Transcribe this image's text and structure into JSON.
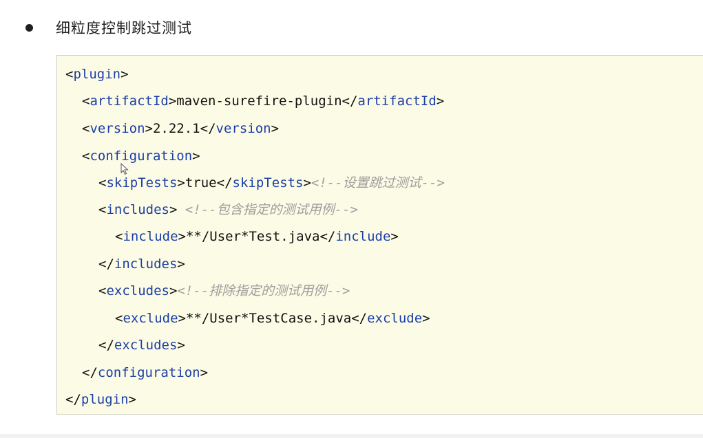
{
  "heading": "细粒度控制跳过测试",
  "code": {
    "plugin_tag": "plugin",
    "artifactId_tag": "artifactId",
    "artifactId_value": "maven-surefire-plugin",
    "version_tag": "version",
    "version_value": "2.22.1",
    "configuration_tag": "configuration",
    "skipTests_tag": "skipTests",
    "skipTests_value": "true",
    "skipTests_comment": "<!--设置跳过测试-->",
    "includes_tag": "includes",
    "includes_comment": "<!--包含指定的测试用例-->",
    "include_tag": "include",
    "include_value": "**/User*Test.java",
    "excludes_tag": "excludes",
    "excludes_comment": "<!--排除指定的测试用例-->",
    "exclude_tag": "exclude",
    "exclude_value": "**/User*TestCase.java"
  }
}
